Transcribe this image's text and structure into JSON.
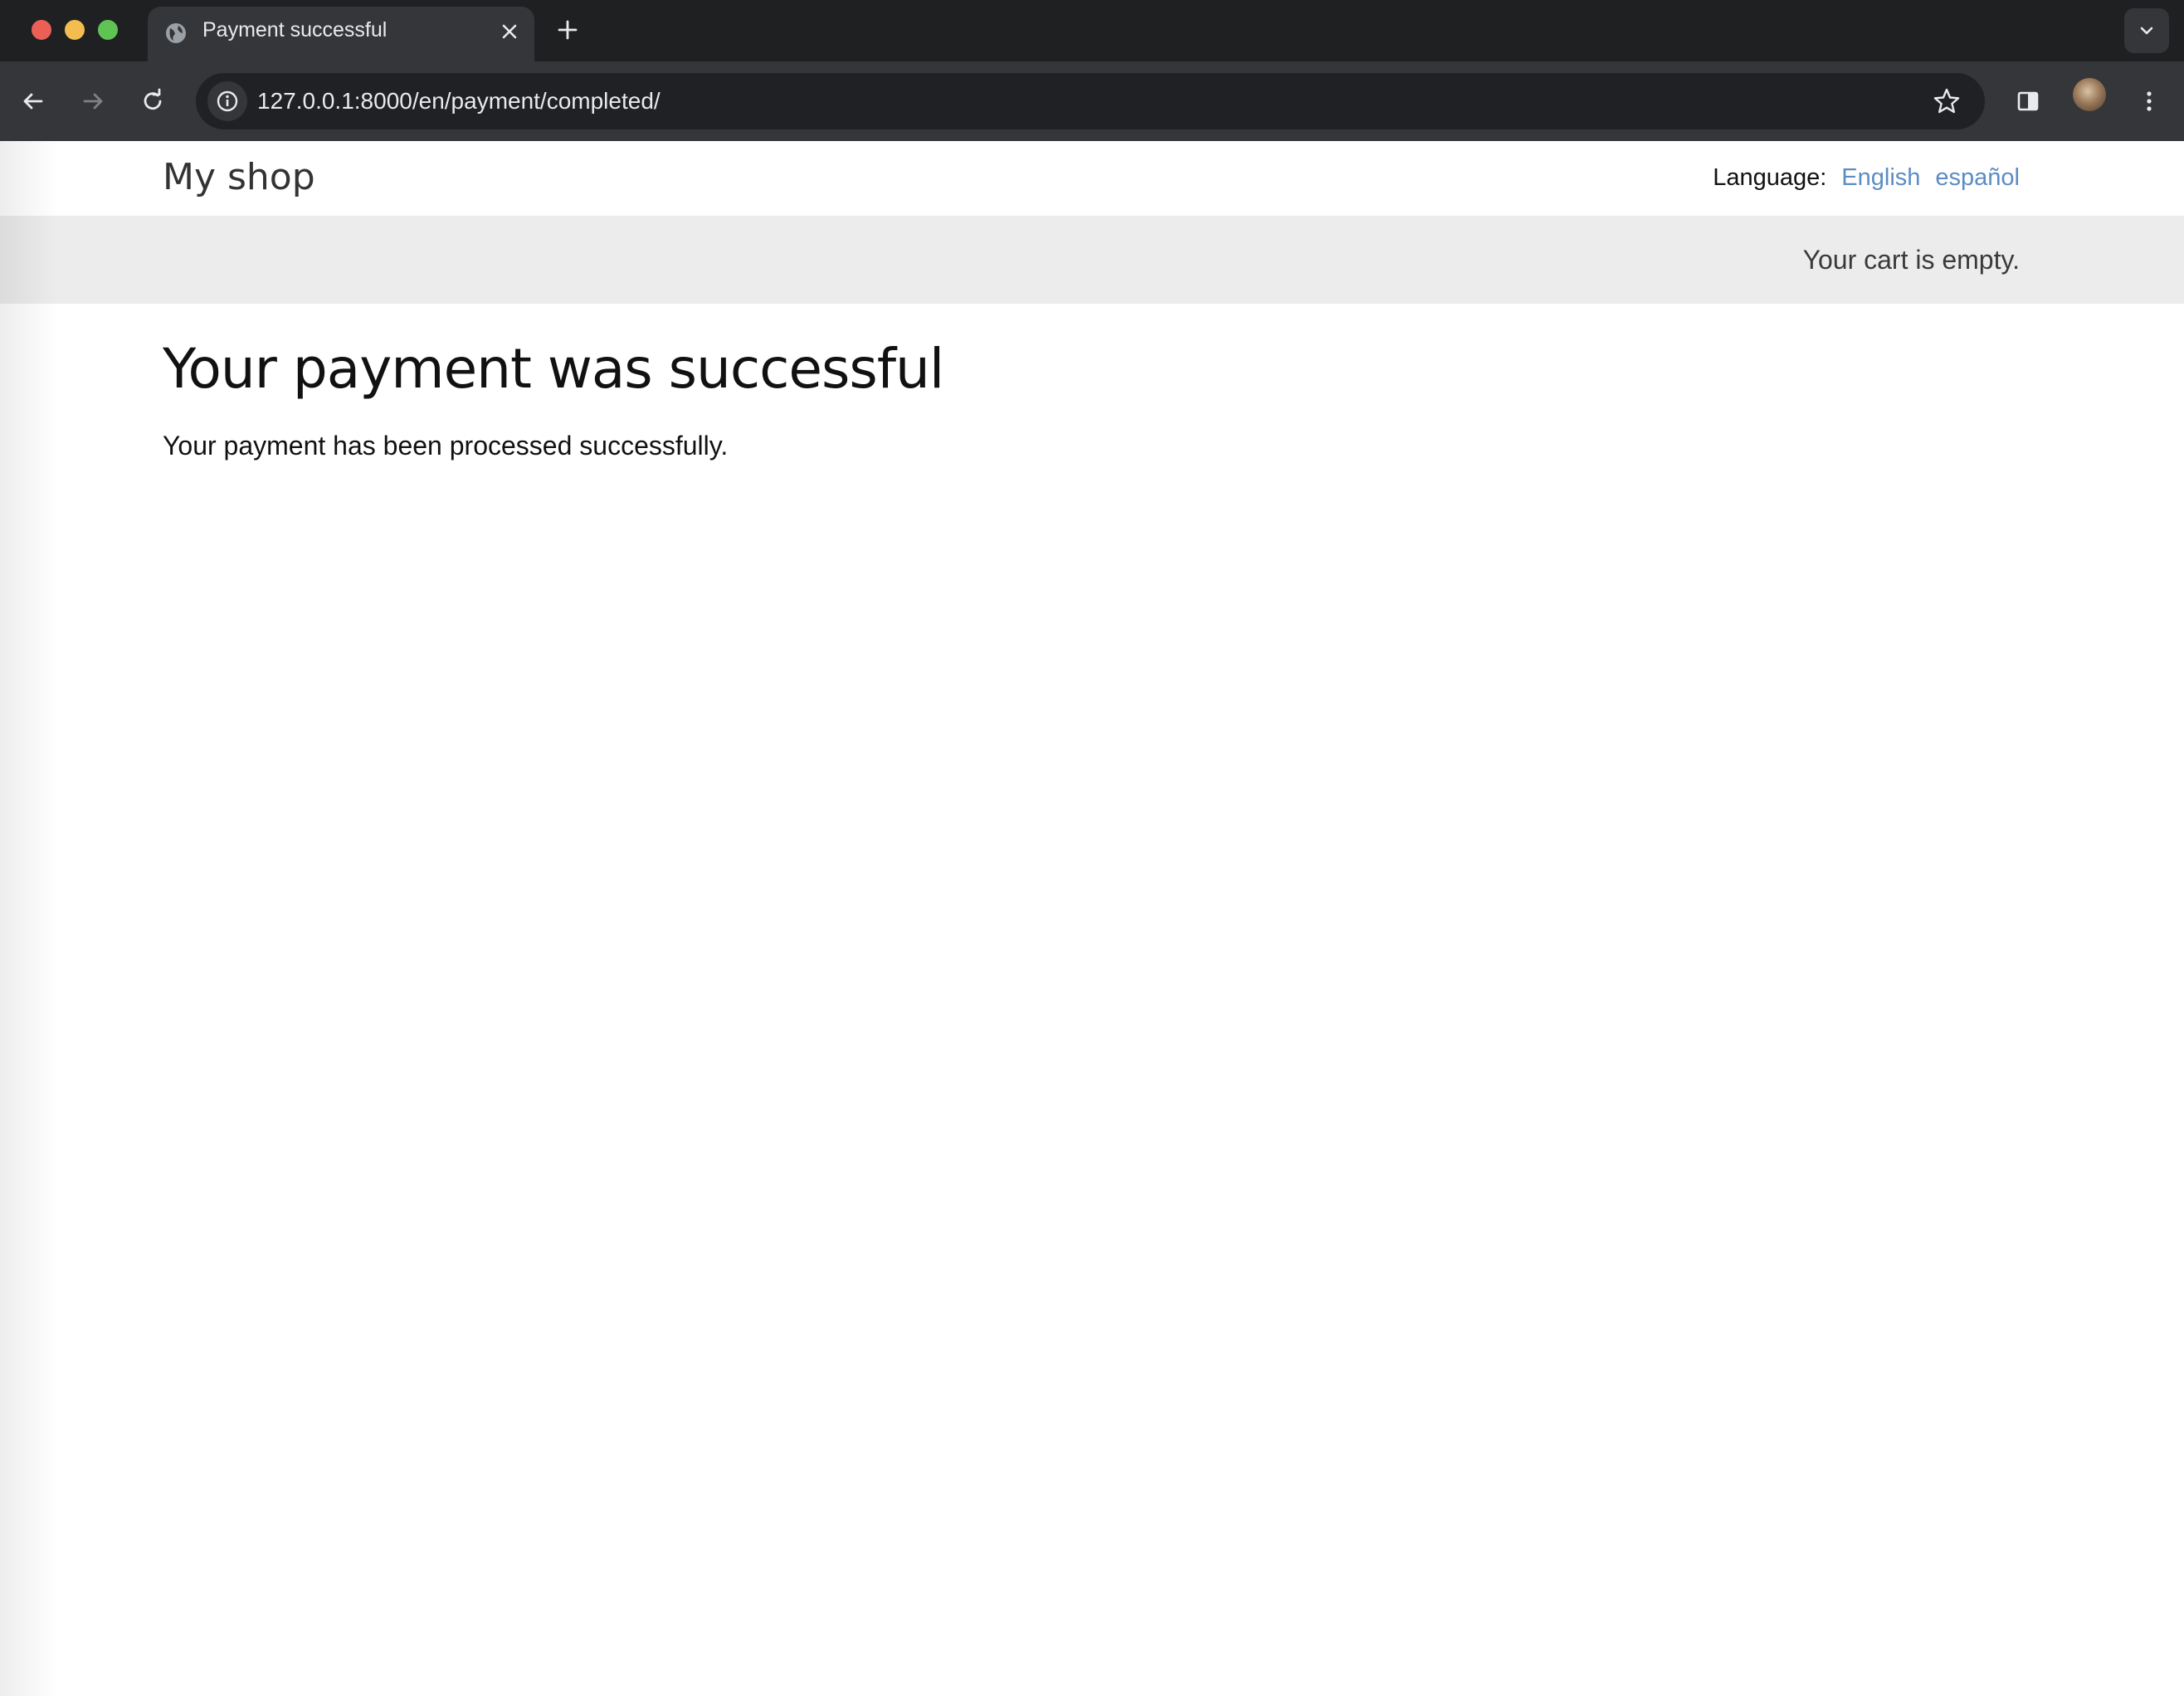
{
  "browser": {
    "tab": {
      "title": "Payment successful"
    },
    "address_bar": {
      "url": "127.0.0.1:8000/en/payment/completed/"
    }
  },
  "site": {
    "logo": "My shop",
    "language_label": "Language:",
    "languages": [
      {
        "label": "English"
      },
      {
        "label": "español"
      }
    ],
    "cart_status": "Your cart is empty."
  },
  "main": {
    "heading": "Your payment was successful",
    "message": "Your payment has been processed successfully."
  },
  "colors": {
    "link": "#5b8cc4",
    "subheader_bg": "#ececec",
    "chrome_dark": "#1f2022",
    "toolbar": "#35363a"
  }
}
